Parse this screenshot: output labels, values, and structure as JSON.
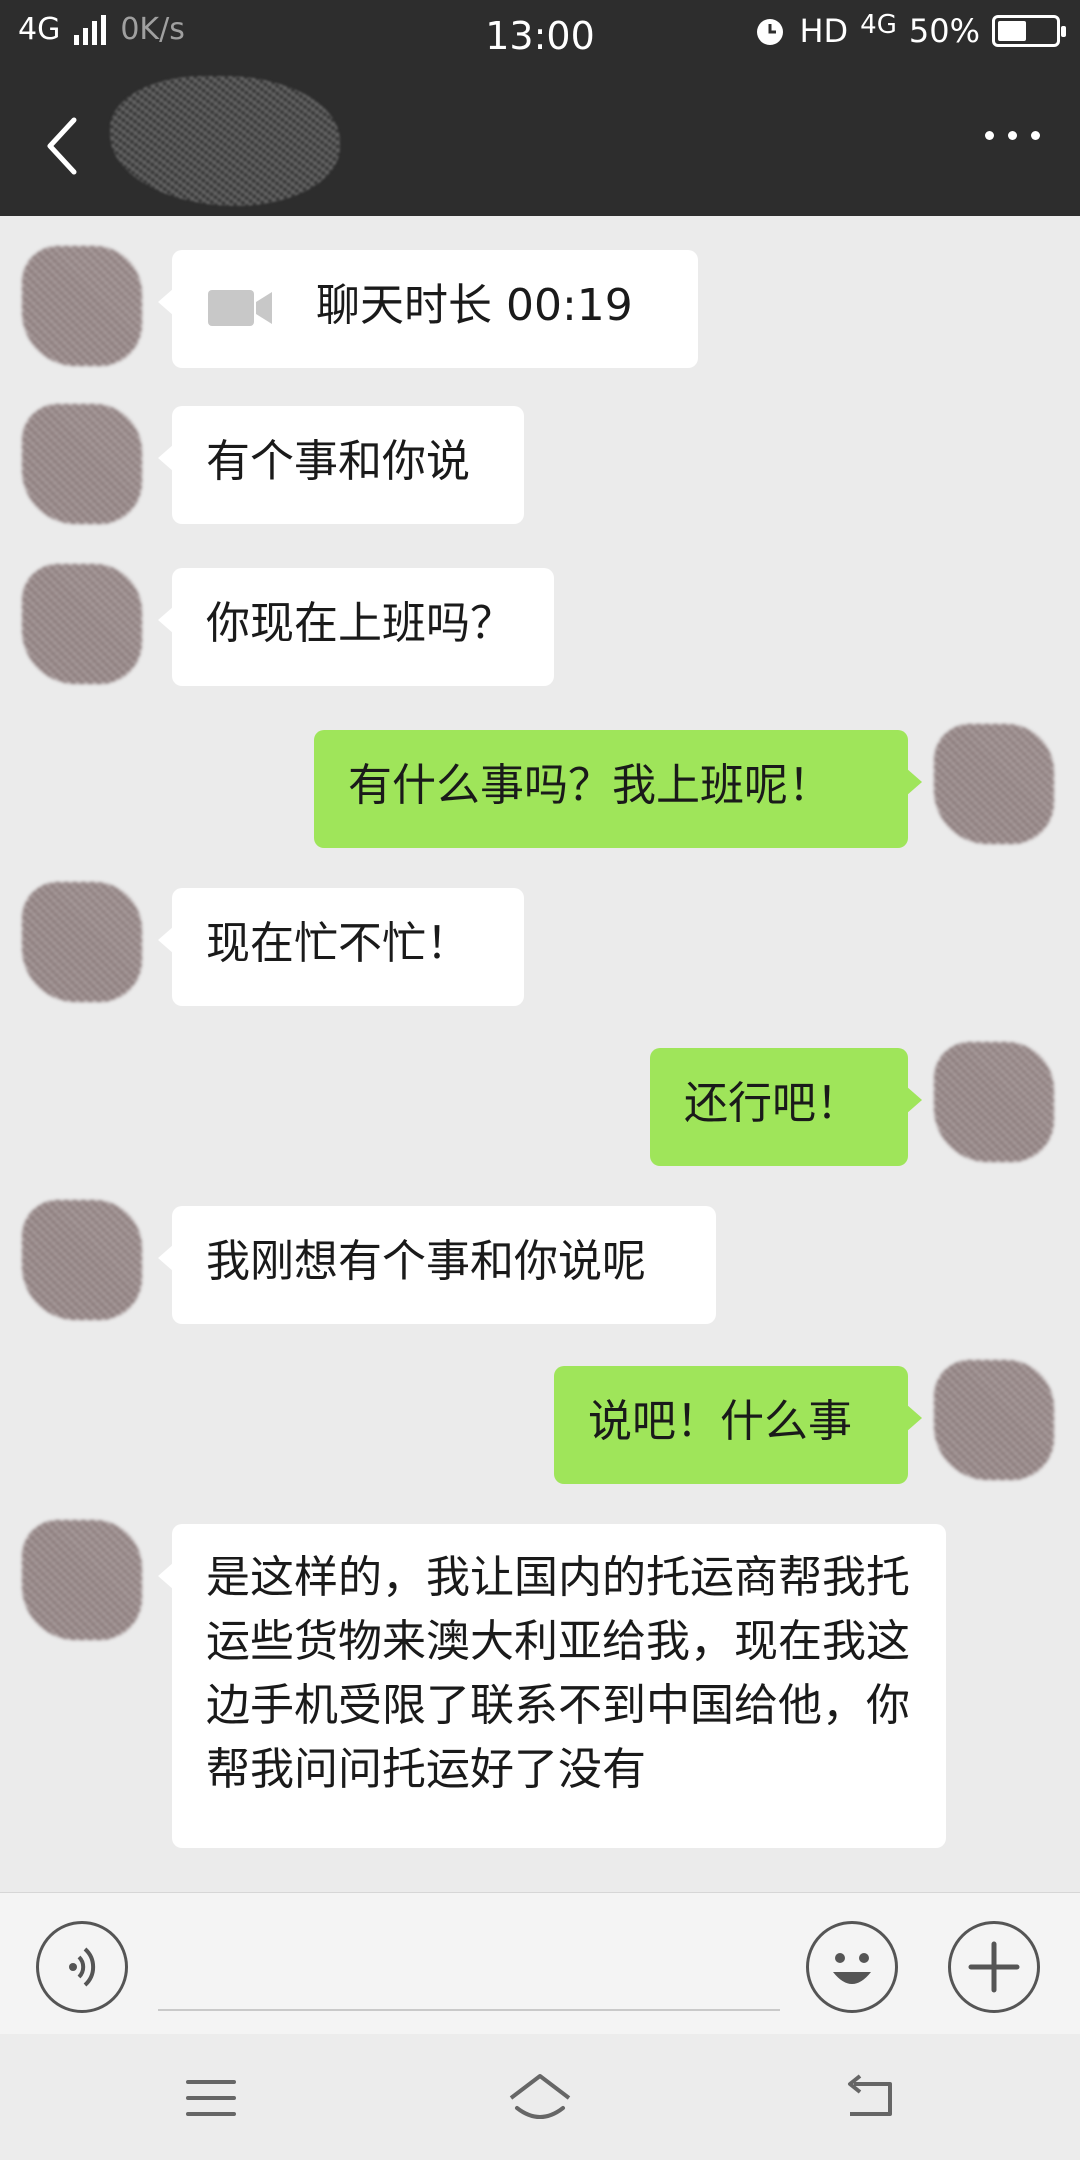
{
  "status_bar": {
    "network": "4G",
    "speed": "0K/s",
    "time": "13:00",
    "hd": "HD",
    "network_right": "4G",
    "battery_text": "50%",
    "battery_level": 0.5
  },
  "chat": {
    "messages": [
      {
        "side": "in",
        "icon": "video-call-icon",
        "text": "聊天时长 00:19"
      },
      {
        "side": "in",
        "text": "有个事和你说"
      },
      {
        "side": "in",
        "text": "你现在上班吗？"
      },
      {
        "side": "out",
        "text": "有什么事吗？我上班呢！"
      },
      {
        "side": "in",
        "text": "现在忙不忙！"
      },
      {
        "side": "out",
        "text": "还行吧！"
      },
      {
        "side": "in",
        "text": "我刚想有个事和你说呢"
      },
      {
        "side": "out",
        "text": "说吧！什么事"
      },
      {
        "side": "in",
        "text": "是这样的，我让国内的托运商帮我托运些货物来澳大利亚给我，现在我这边手机受限了联系不到中国给他，你帮我问问托运好了没有"
      }
    ]
  },
  "colors": {
    "header_bg": "#2d2d2d",
    "chat_bg": "#ebebeb",
    "incoming_bubble": "#ffffff",
    "outgoing_bubble": "#9fe55a"
  }
}
